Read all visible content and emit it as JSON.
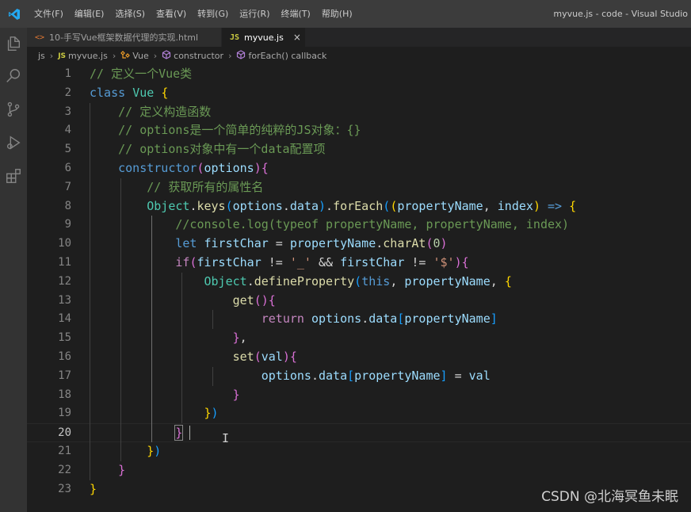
{
  "titlebar": {
    "menu": [
      "文件(F)",
      "编辑(E)",
      "选择(S)",
      "查看(V)",
      "转到(G)",
      "运行(R)",
      "终端(T)",
      "帮助(H)"
    ],
    "window_title": "myvue.js - code - Visual Studio"
  },
  "tabs": [
    {
      "icon": "<>",
      "label": "10-手写Vue框架数据代理的实现.html",
      "active": false
    },
    {
      "icon": "JS",
      "label": "myvue.js",
      "active": true,
      "close": "×"
    }
  ],
  "breadcrumb": [
    "js",
    "myvue.js",
    "Vue",
    "constructor",
    "forEach() callback"
  ],
  "editor": {
    "current_line": 20,
    "lines": [
      {
        "n": "1",
        "tokens": [
          [
            "// 定义一个Vue类",
            "tk-comment"
          ]
        ]
      },
      {
        "n": "2",
        "tokens": [
          [
            "class ",
            "tk-keyword"
          ],
          [
            "Vue ",
            "tk-class"
          ],
          [
            "{",
            "tk-brace1"
          ]
        ]
      },
      {
        "n": "3",
        "tokens": [
          [
            "    "
          ],
          [
            "// 定义构造函数",
            "tk-comment"
          ]
        ]
      },
      {
        "n": "4",
        "tokens": [
          [
            "    "
          ],
          [
            "// options是一个简单的纯粹的JS对象：{}",
            "tk-comment"
          ]
        ]
      },
      {
        "n": "5",
        "tokens": [
          [
            "    "
          ],
          [
            "// options对象中有一个data配置项",
            "tk-comment"
          ]
        ]
      },
      {
        "n": "6",
        "tokens": [
          [
            "    "
          ],
          [
            "constructor",
            "tk-keyword"
          ],
          [
            "(",
            "tk-brace2"
          ],
          [
            "options",
            "tk-var"
          ],
          [
            ")",
            "tk-brace2"
          ],
          [
            "{",
            "tk-brace2"
          ]
        ]
      },
      {
        "n": "7",
        "tokens": [
          [
            "        "
          ],
          [
            "// 获取所有的属性名",
            "tk-comment"
          ]
        ]
      },
      {
        "n": "8",
        "tokens": [
          [
            "        "
          ],
          [
            "Object",
            "tk-class"
          ],
          [
            ".",
            "tk-op"
          ],
          [
            "keys",
            "tk-func"
          ],
          [
            "(",
            "tk-brace3"
          ],
          [
            "options",
            "tk-var"
          ],
          [
            ".",
            "tk-op"
          ],
          [
            "data",
            "tk-var"
          ],
          [
            ")",
            "tk-brace3"
          ],
          [
            ".",
            "tk-op"
          ],
          [
            "forEach",
            "tk-func"
          ],
          [
            "(",
            "tk-brace3"
          ],
          [
            "(",
            "tk-brace1"
          ],
          [
            "propertyName",
            "tk-var"
          ],
          [
            ", ",
            "tk-op"
          ],
          [
            "index",
            "tk-var"
          ],
          [
            ")",
            "tk-brace1"
          ],
          [
            " => ",
            "tk-keyword"
          ],
          [
            "{",
            "tk-brace1"
          ]
        ]
      },
      {
        "n": "9",
        "tokens": [
          [
            "            "
          ],
          [
            "//console.log(typeof propertyName, propertyName, index)",
            "tk-comment"
          ]
        ]
      },
      {
        "n": "10",
        "tokens": [
          [
            "            "
          ],
          [
            "let ",
            "tk-keyword"
          ],
          [
            "firstChar",
            "tk-var"
          ],
          [
            " = ",
            "tk-op"
          ],
          [
            "propertyName",
            "tk-var"
          ],
          [
            ".",
            "tk-op"
          ],
          [
            "charAt",
            "tk-func"
          ],
          [
            "(",
            "tk-brace2"
          ],
          [
            "0",
            "tk-number"
          ],
          [
            ")",
            "tk-brace2"
          ]
        ]
      },
      {
        "n": "11",
        "tokens": [
          [
            "            "
          ],
          [
            "if",
            "tk-control"
          ],
          [
            "(",
            "tk-brace2"
          ],
          [
            "firstChar",
            "tk-var"
          ],
          [
            " != ",
            "tk-op"
          ],
          [
            "'_'",
            "tk-string"
          ],
          [
            " && ",
            "tk-op"
          ],
          [
            "firstChar",
            "tk-var"
          ],
          [
            " != ",
            "tk-op"
          ],
          [
            "'$'",
            "tk-string"
          ],
          [
            ")",
            "tk-brace2"
          ],
          [
            "{",
            "tk-brace2"
          ]
        ]
      },
      {
        "n": "12",
        "tokens": [
          [
            "                "
          ],
          [
            "Object",
            "tk-class"
          ],
          [
            ".",
            "tk-op"
          ],
          [
            "defineProperty",
            "tk-func"
          ],
          [
            "(",
            "tk-brace3"
          ],
          [
            "this",
            "tk-keyword"
          ],
          [
            ", ",
            "tk-op"
          ],
          [
            "propertyName",
            "tk-var"
          ],
          [
            ", ",
            "tk-op"
          ],
          [
            "{",
            "tk-brace1"
          ]
        ]
      },
      {
        "n": "13",
        "tokens": [
          [
            "                    "
          ],
          [
            "get",
            "tk-func"
          ],
          [
            "(",
            "tk-brace2"
          ],
          [
            ")",
            "tk-brace2"
          ],
          [
            "{",
            "tk-brace2"
          ]
        ]
      },
      {
        "n": "14",
        "tokens": [
          [
            "                        "
          ],
          [
            "return ",
            "tk-control"
          ],
          [
            "options",
            "tk-var"
          ],
          [
            ".",
            "tk-op"
          ],
          [
            "data",
            "tk-var"
          ],
          [
            "[",
            "tk-brace3"
          ],
          [
            "propertyName",
            "tk-var"
          ],
          [
            "]",
            "tk-brace3"
          ]
        ]
      },
      {
        "n": "15",
        "tokens": [
          [
            "                    "
          ],
          [
            "}",
            "tk-brace2"
          ],
          [
            ",",
            "tk-op"
          ]
        ]
      },
      {
        "n": "16",
        "tokens": [
          [
            "                    "
          ],
          [
            "set",
            "tk-func"
          ],
          [
            "(",
            "tk-brace2"
          ],
          [
            "val",
            "tk-var"
          ],
          [
            ")",
            "tk-brace2"
          ],
          [
            "{",
            "tk-brace2"
          ]
        ]
      },
      {
        "n": "17",
        "tokens": [
          [
            "                        "
          ],
          [
            "options",
            "tk-var"
          ],
          [
            ".",
            "tk-op"
          ],
          [
            "data",
            "tk-var"
          ],
          [
            "[",
            "tk-brace3"
          ],
          [
            "propertyName",
            "tk-var"
          ],
          [
            "]",
            "tk-brace3"
          ],
          [
            " = ",
            "tk-op"
          ],
          [
            "val",
            "tk-var"
          ]
        ]
      },
      {
        "n": "18",
        "tokens": [
          [
            "                    "
          ],
          [
            "}",
            "tk-brace2"
          ]
        ]
      },
      {
        "n": "19",
        "tokens": [
          [
            "                "
          ],
          [
            "}",
            "tk-brace1"
          ],
          [
            ")",
            "tk-brace3"
          ]
        ]
      },
      {
        "n": "20",
        "tokens": [
          [
            "            "
          ],
          [
            "}",
            "tk-brace2"
          ]
        ]
      },
      {
        "n": "21",
        "tokens": [
          [
            "        "
          ],
          [
            "}",
            "tk-brace1"
          ],
          [
            ")",
            "tk-brace3"
          ]
        ]
      },
      {
        "n": "22",
        "tokens": [
          [
            "    "
          ],
          [
            "}",
            "tk-brace2"
          ]
        ]
      },
      {
        "n": "23",
        "tokens": [
          [
            "}",
            "tk-brace1"
          ]
        ]
      }
    ]
  },
  "watermark": "CSDN @北海冥鱼未眠",
  "colors": {
    "editor_bg": "#1e1e1e",
    "titlebar_bg": "#3c3c3c",
    "activitybar_bg": "#333333",
    "accent": "#007acc"
  }
}
